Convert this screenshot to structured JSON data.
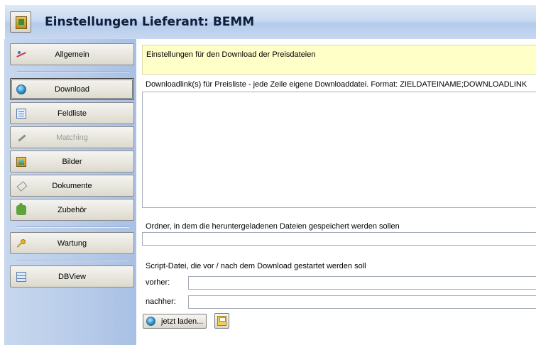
{
  "header": {
    "title": "Einstellungen Lieferant: BEMM",
    "icon": "settings-icon"
  },
  "sidebar": {
    "items": [
      {
        "label": "Allgemein",
        "icon": "chart-icon",
        "state": "normal"
      },
      {
        "label": "Download",
        "icon": "globe-icon",
        "state": "selected"
      },
      {
        "label": "Feldliste",
        "icon": "list-icon",
        "state": "normal"
      },
      {
        "label": "Matching",
        "icon": "pen-icon",
        "state": "disabled"
      },
      {
        "label": "Bilder",
        "icon": "picture-icon",
        "state": "normal"
      },
      {
        "label": "Dokumente",
        "icon": "document-icon",
        "state": "normal"
      },
      {
        "label": "Zubehör",
        "icon": "puzzle-icon",
        "state": "normal"
      },
      {
        "label": "Wartung",
        "icon": "key-icon",
        "state": "normal"
      },
      {
        "label": "DBView",
        "icon": "grid-icon",
        "state": "normal"
      }
    ]
  },
  "main": {
    "info_text": "Einstellungen für den Download der Preisdateien",
    "downloadlinks_label": "Downloadlink(s) für Preisliste - jede Zeile eigene Downloaddatei. Format: ZIELDATEINAME;DOWNLOADLINK",
    "downloadlinks_value": "",
    "folder_label": "Ordner, in dem die heruntergeladenen Dateien gespeichert werden sollen",
    "folder_value": "",
    "script_label": "Script-Datei, die vor / nach dem Download gestartet werden soll",
    "vorher_label": "vorher:",
    "vorher_value": "",
    "nachher_label": "nachher:",
    "nachher_value": "",
    "load_button": "jetzt laden...",
    "save_button_icon": "save-icon"
  },
  "colors": {
    "header_gradient": "#c9daf2",
    "sidebar_gradient": "#b7cbe9",
    "info_background": "#ffffc8",
    "button_face": "#e9e7df"
  }
}
